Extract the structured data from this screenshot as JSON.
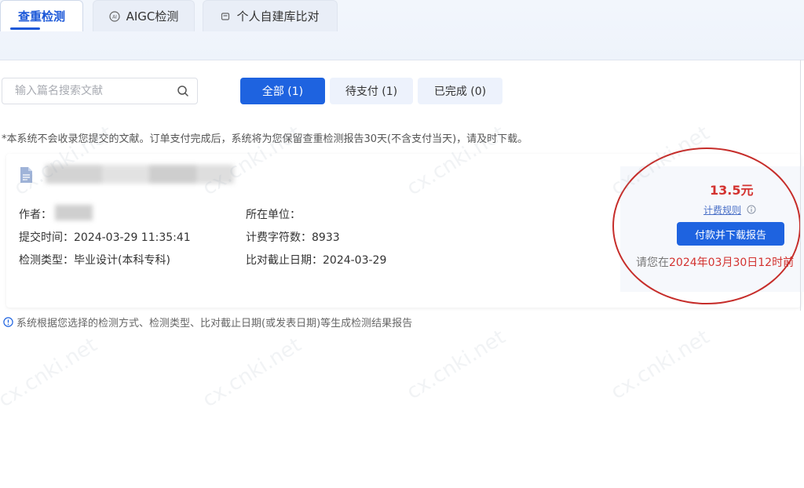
{
  "tabs": [
    {
      "label": "查重检测",
      "active": true
    },
    {
      "label": "AIGC检测",
      "icon": "ai-icon"
    },
    {
      "label": "个人自建库比对",
      "icon": "database-icon"
    }
  ],
  "search": {
    "placeholder": "输入篇名搜索文献",
    "value": ""
  },
  "filters": {
    "all": "全部 (1)",
    "pending": "待支付 (1)",
    "done": "已完成 (0)"
  },
  "notice": "*本系统不会收录您提交的文献。订单支付完成后，系统将为您保留查重检测报告30天(不含支付当天)，请及时下载。",
  "record": {
    "author_label": "作者：",
    "submit_time_label": "提交时间：",
    "submit_time": "2024-03-29 11:35:41",
    "check_type_label": "检测类型：",
    "check_type": "毕业设计(本科专科)",
    "unit_label": "所在单位：",
    "unit": "",
    "char_count_label": "计费字符数：",
    "char_count": "8933",
    "deadline_label": "比对截止日期：",
    "deadline": "2024-03-29"
  },
  "payment": {
    "price": "13.5元",
    "rule_link": "计费规则",
    "button": "付款并下载报告",
    "deadline_prefix": "请您在",
    "deadline_time": "2024年03月30日12时前"
  },
  "footnote": "系统根据您选择的检测方式、检测类型、比对截止日期(或发表日期)等生成检测结果报告",
  "watermark": "cx.cnki.net",
  "colors": {
    "primary": "#1e63e0",
    "price_red": "#d3322f",
    "annotation_red": "#c62d2a"
  }
}
